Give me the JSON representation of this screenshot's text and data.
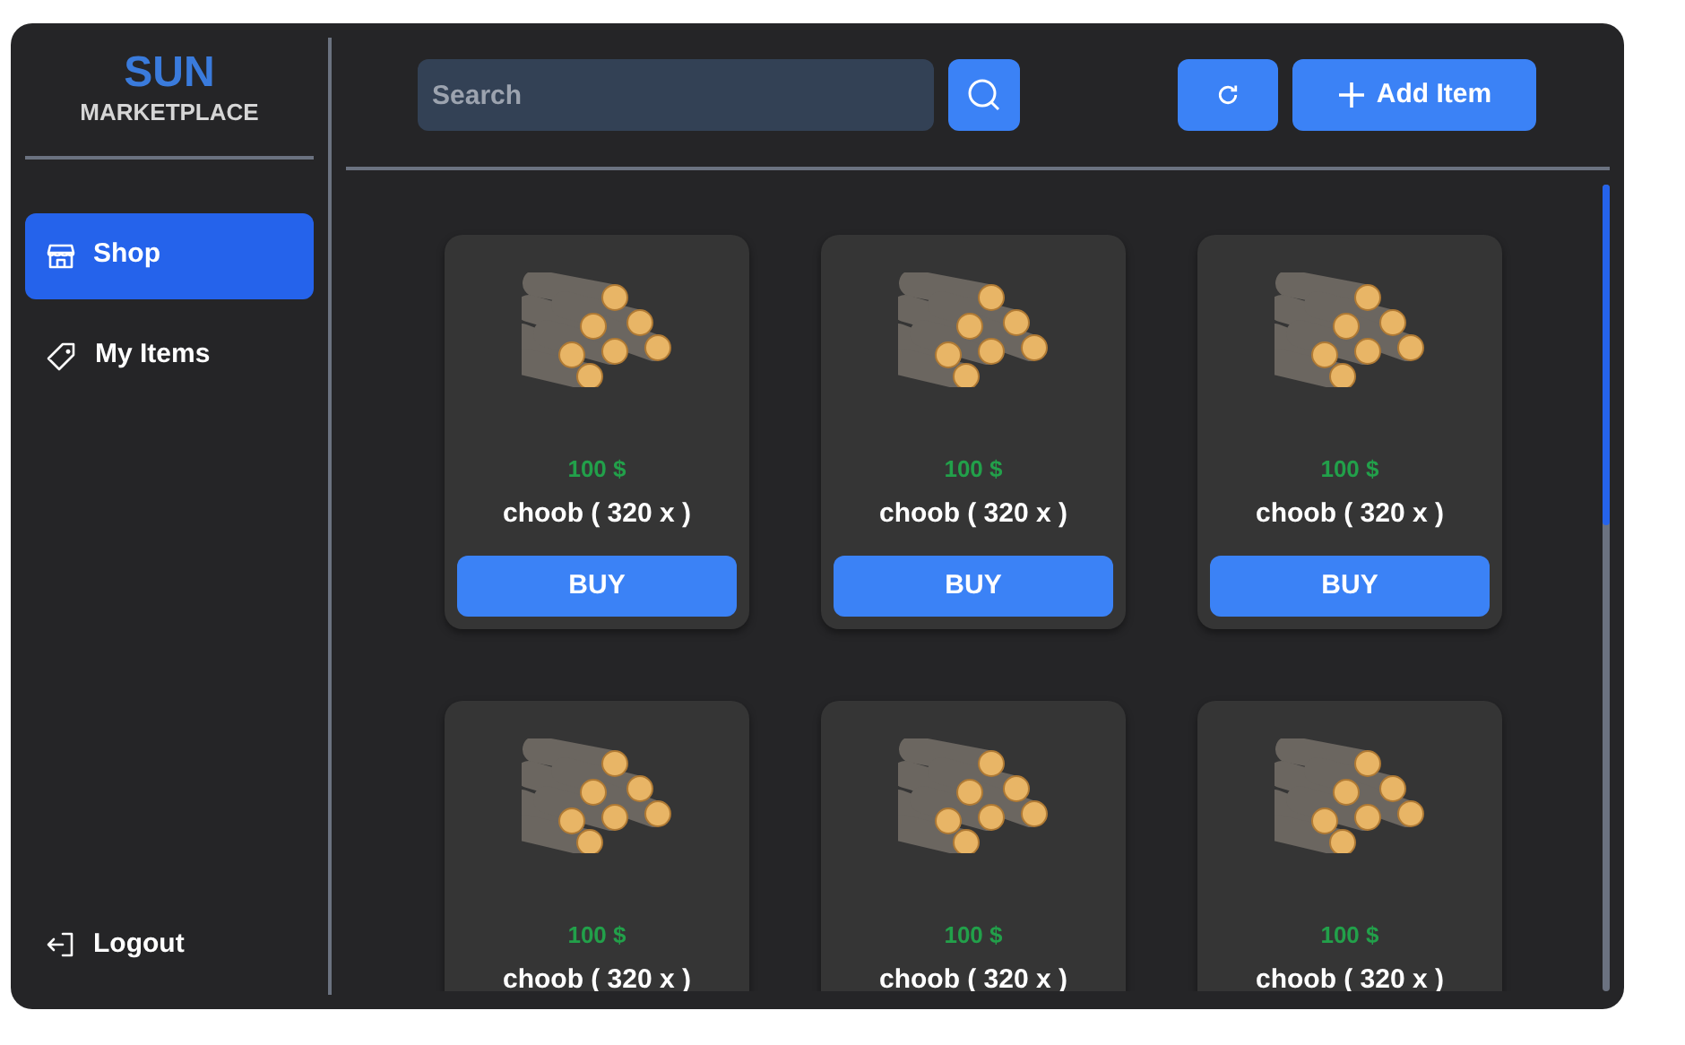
{
  "brand": {
    "title": "SUN",
    "subtitle": "MARKETPLACE"
  },
  "sidebar": {
    "items": [
      {
        "label": "Shop",
        "selected": true
      },
      {
        "label": "My Items",
        "selected": false
      }
    ],
    "logout": "Logout"
  },
  "toolbar": {
    "search": {
      "placeholder": "Search"
    },
    "add_button": "Add Item"
  },
  "products": [
    {
      "price": "100 $",
      "name": "choob ( 320 x )",
      "button": "BUY"
    },
    {
      "price": "100 $",
      "name": "choob ( 320 x )",
      "button": "BUY"
    },
    {
      "price": "100 $",
      "name": "choob ( 320 x )",
      "button": "BUY"
    },
    {
      "price": "100 $",
      "name": "choob ( 320 x )"
    },
    {
      "price": "100 $",
      "name": "choob ( 320 x )"
    },
    {
      "price": "100 $",
      "name": "choob ( 320 x )"
    }
  ]
}
